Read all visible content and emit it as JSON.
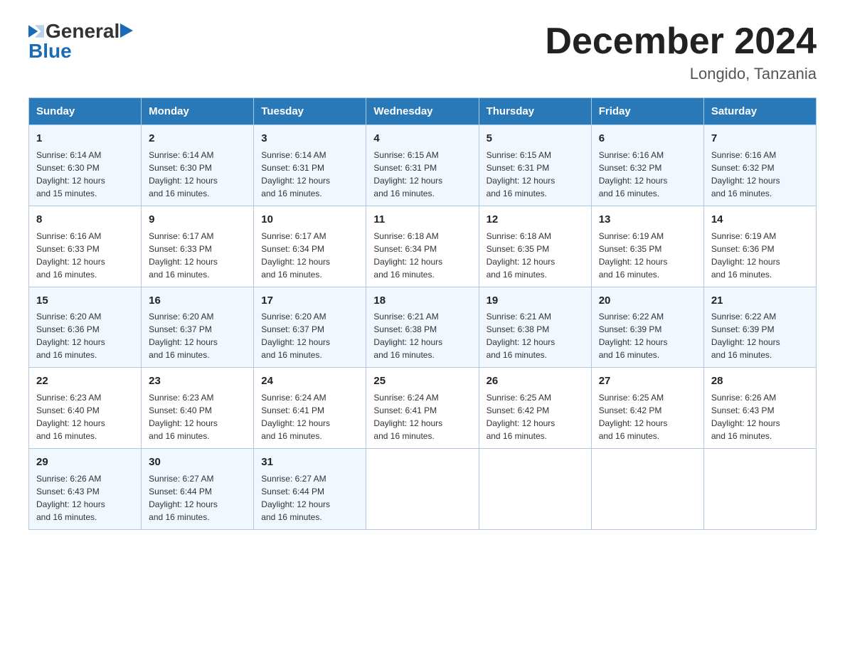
{
  "header": {
    "logo_general": "General",
    "logo_blue": "Blue",
    "month_title": "December 2024",
    "location": "Longido, Tanzania"
  },
  "weekdays": [
    "Sunday",
    "Monday",
    "Tuesday",
    "Wednesday",
    "Thursday",
    "Friday",
    "Saturday"
  ],
  "weeks": [
    [
      {
        "day": "1",
        "sunrise": "6:14 AM",
        "sunset": "6:30 PM",
        "daylight": "12 hours and 15 minutes."
      },
      {
        "day": "2",
        "sunrise": "6:14 AM",
        "sunset": "6:30 PM",
        "daylight": "12 hours and 16 minutes."
      },
      {
        "day": "3",
        "sunrise": "6:14 AM",
        "sunset": "6:31 PM",
        "daylight": "12 hours and 16 minutes."
      },
      {
        "day": "4",
        "sunrise": "6:15 AM",
        "sunset": "6:31 PM",
        "daylight": "12 hours and 16 minutes."
      },
      {
        "day": "5",
        "sunrise": "6:15 AM",
        "sunset": "6:31 PM",
        "daylight": "12 hours and 16 minutes."
      },
      {
        "day": "6",
        "sunrise": "6:16 AM",
        "sunset": "6:32 PM",
        "daylight": "12 hours and 16 minutes."
      },
      {
        "day": "7",
        "sunrise": "6:16 AM",
        "sunset": "6:32 PM",
        "daylight": "12 hours and 16 minutes."
      }
    ],
    [
      {
        "day": "8",
        "sunrise": "6:16 AM",
        "sunset": "6:33 PM",
        "daylight": "12 hours and 16 minutes."
      },
      {
        "day": "9",
        "sunrise": "6:17 AM",
        "sunset": "6:33 PM",
        "daylight": "12 hours and 16 minutes."
      },
      {
        "day": "10",
        "sunrise": "6:17 AM",
        "sunset": "6:34 PM",
        "daylight": "12 hours and 16 minutes."
      },
      {
        "day": "11",
        "sunrise": "6:18 AM",
        "sunset": "6:34 PM",
        "daylight": "12 hours and 16 minutes."
      },
      {
        "day": "12",
        "sunrise": "6:18 AM",
        "sunset": "6:35 PM",
        "daylight": "12 hours and 16 minutes."
      },
      {
        "day": "13",
        "sunrise": "6:19 AM",
        "sunset": "6:35 PM",
        "daylight": "12 hours and 16 minutes."
      },
      {
        "day": "14",
        "sunrise": "6:19 AM",
        "sunset": "6:36 PM",
        "daylight": "12 hours and 16 minutes."
      }
    ],
    [
      {
        "day": "15",
        "sunrise": "6:20 AM",
        "sunset": "6:36 PM",
        "daylight": "12 hours and 16 minutes."
      },
      {
        "day": "16",
        "sunrise": "6:20 AM",
        "sunset": "6:37 PM",
        "daylight": "12 hours and 16 minutes."
      },
      {
        "day": "17",
        "sunrise": "6:20 AM",
        "sunset": "6:37 PM",
        "daylight": "12 hours and 16 minutes."
      },
      {
        "day": "18",
        "sunrise": "6:21 AM",
        "sunset": "6:38 PM",
        "daylight": "12 hours and 16 minutes."
      },
      {
        "day": "19",
        "sunrise": "6:21 AM",
        "sunset": "6:38 PM",
        "daylight": "12 hours and 16 minutes."
      },
      {
        "day": "20",
        "sunrise": "6:22 AM",
        "sunset": "6:39 PM",
        "daylight": "12 hours and 16 minutes."
      },
      {
        "day": "21",
        "sunrise": "6:22 AM",
        "sunset": "6:39 PM",
        "daylight": "12 hours and 16 minutes."
      }
    ],
    [
      {
        "day": "22",
        "sunrise": "6:23 AM",
        "sunset": "6:40 PM",
        "daylight": "12 hours and 16 minutes."
      },
      {
        "day": "23",
        "sunrise": "6:23 AM",
        "sunset": "6:40 PM",
        "daylight": "12 hours and 16 minutes."
      },
      {
        "day": "24",
        "sunrise": "6:24 AM",
        "sunset": "6:41 PM",
        "daylight": "12 hours and 16 minutes."
      },
      {
        "day": "25",
        "sunrise": "6:24 AM",
        "sunset": "6:41 PM",
        "daylight": "12 hours and 16 minutes."
      },
      {
        "day": "26",
        "sunrise": "6:25 AM",
        "sunset": "6:42 PM",
        "daylight": "12 hours and 16 minutes."
      },
      {
        "day": "27",
        "sunrise": "6:25 AM",
        "sunset": "6:42 PM",
        "daylight": "12 hours and 16 minutes."
      },
      {
        "day": "28",
        "sunrise": "6:26 AM",
        "sunset": "6:43 PM",
        "daylight": "12 hours and 16 minutes."
      }
    ],
    [
      {
        "day": "29",
        "sunrise": "6:26 AM",
        "sunset": "6:43 PM",
        "daylight": "12 hours and 16 minutes."
      },
      {
        "day": "30",
        "sunrise": "6:27 AM",
        "sunset": "6:44 PM",
        "daylight": "12 hours and 16 minutes."
      },
      {
        "day": "31",
        "sunrise": "6:27 AM",
        "sunset": "6:44 PM",
        "daylight": "12 hours and 16 minutes."
      },
      null,
      null,
      null,
      null
    ]
  ],
  "labels": {
    "sunrise": "Sunrise:",
    "sunset": "Sunset:",
    "daylight": "Daylight:"
  }
}
